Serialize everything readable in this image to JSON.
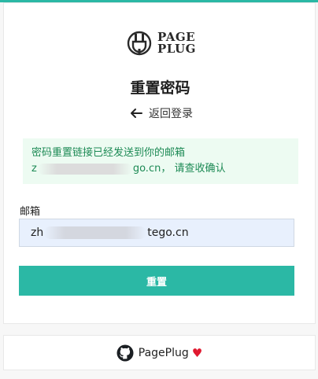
{
  "logo": {
    "line1": "PAGE",
    "line2": "PLUG"
  },
  "page_title": "重置密码",
  "back_link": {
    "label": "返回登录",
    "icon": "arrow-left-icon"
  },
  "alert": {
    "line1": "密码重置链接已经发送到你的邮箱",
    "email_prefix": "z",
    "email_mid": "go.cn",
    "line2_suffix": "， 请查收确认",
    "color": "#1d8a55",
    "background": "#edfbf2"
  },
  "form": {
    "email_label": "邮箱",
    "email_prefix": "zh",
    "email_suffix": "tego.cn"
  },
  "reset_button": {
    "label": "重置",
    "color": "#2bb8a5"
  },
  "footer": {
    "label": "PagePlug",
    "heart": "♥",
    "icon": "github-icon"
  }
}
